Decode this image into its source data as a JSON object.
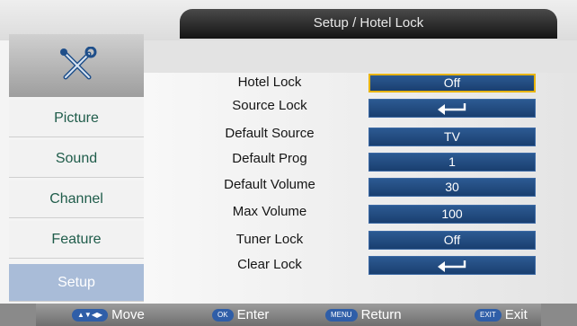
{
  "title": "Setup / Hotel Lock",
  "sidebar": {
    "logo_icon": "tools-icon",
    "items": [
      {
        "label": "Picture",
        "active": false
      },
      {
        "label": "Sound",
        "active": false
      },
      {
        "label": "Channel",
        "active": false
      },
      {
        "label": "Feature",
        "active": false
      },
      {
        "label": "Setup",
        "active": true
      }
    ]
  },
  "settings": [
    {
      "label": "Hotel Lock",
      "value": "Off",
      "selected": true
    },
    {
      "label": "Source Lock",
      "value": "",
      "icon": "enter-icon"
    },
    {
      "label": "Default Source",
      "value": "TV"
    },
    {
      "label": "Default Prog",
      "value": "1"
    },
    {
      "label": "Default Volume",
      "value": "30"
    },
    {
      "label": "Max Volume",
      "value": "100"
    },
    {
      "label": "Tuner Lock",
      "value": "Off"
    },
    {
      "label": "Clear Lock",
      "value": "",
      "icon": "enter-icon"
    }
  ],
  "hints": {
    "move": {
      "key": "▲▼◀▶",
      "label": "Move"
    },
    "enter": {
      "key": "OK",
      "label": "Enter"
    },
    "return": {
      "key": "MENU",
      "label": "Return"
    },
    "exit": {
      "key": "EXIT",
      "label": "Exit"
    }
  },
  "colors": {
    "value_box": "#1f4a80",
    "selection": "#e8b40c",
    "active_tab": "#a9bcd8",
    "side_text": "#1f5c4a"
  }
}
